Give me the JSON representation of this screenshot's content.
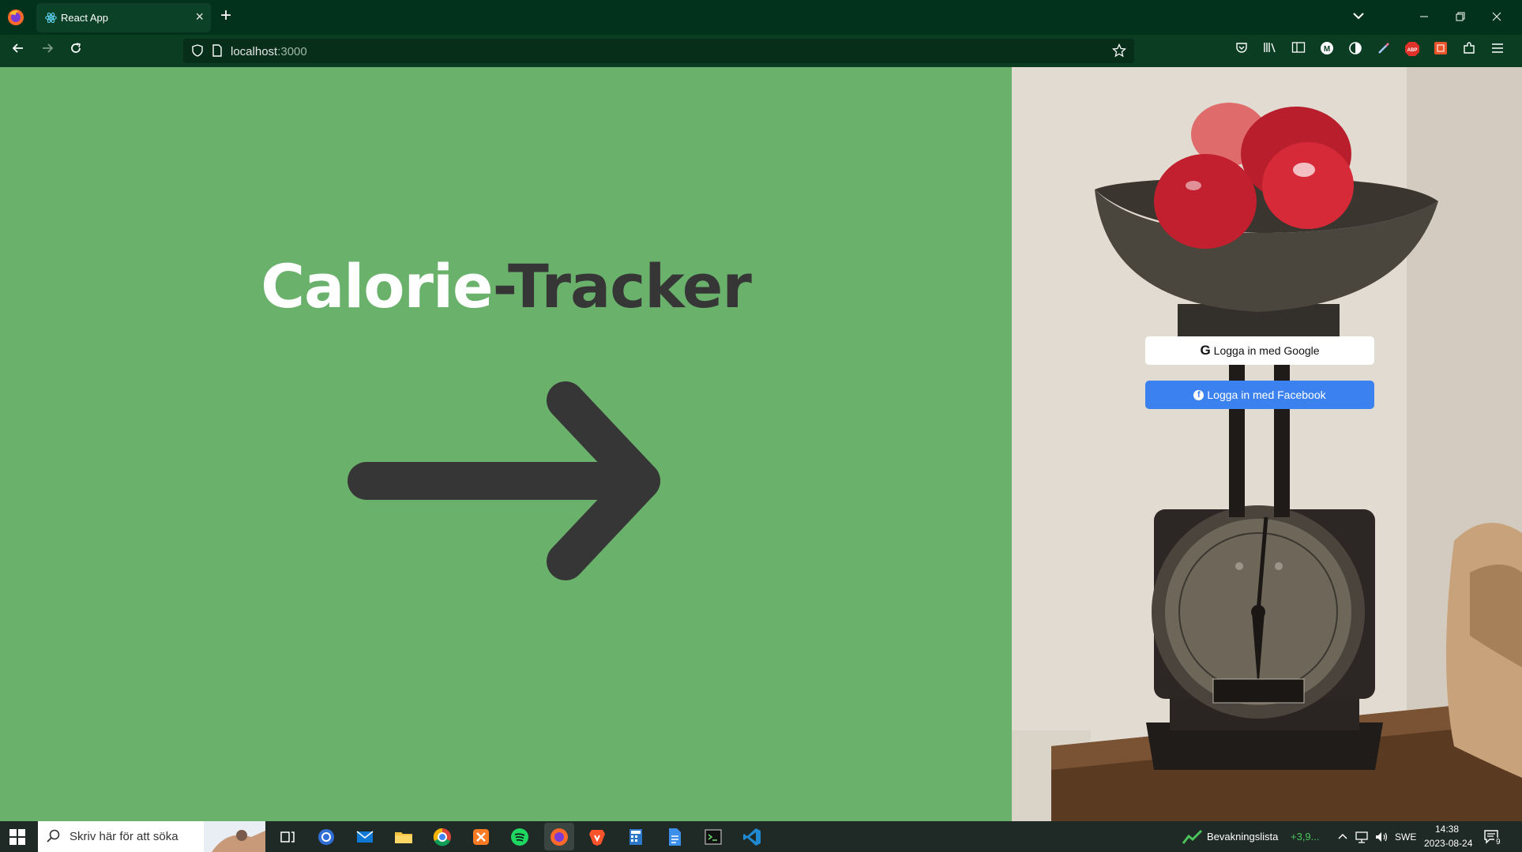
{
  "browser": {
    "tab_title": "React App",
    "new_tab_symbol": "+",
    "close_symbol": "×",
    "url_host": "localhost",
    "url_port": ":3000"
  },
  "app": {
    "title_part1": "Calorie",
    "title_part2": "-Tracker",
    "google_button": "Logga in med Google",
    "google_icon": "G",
    "facebook_button": "Logga in med Facebook",
    "facebook_icon": "f",
    "colors": {
      "left_bg": "#6ab26c",
      "dark_text": "#363636",
      "facebook_blue": "#3b82f0"
    }
  },
  "taskbar": {
    "search_placeholder": "Skriv här för att söka",
    "watchlist_label": "Bevakningslista",
    "watchlist_value": "+3,9...",
    "language": "SWE",
    "time": "14:38",
    "date": "2023-08-24",
    "notifications": "9"
  }
}
